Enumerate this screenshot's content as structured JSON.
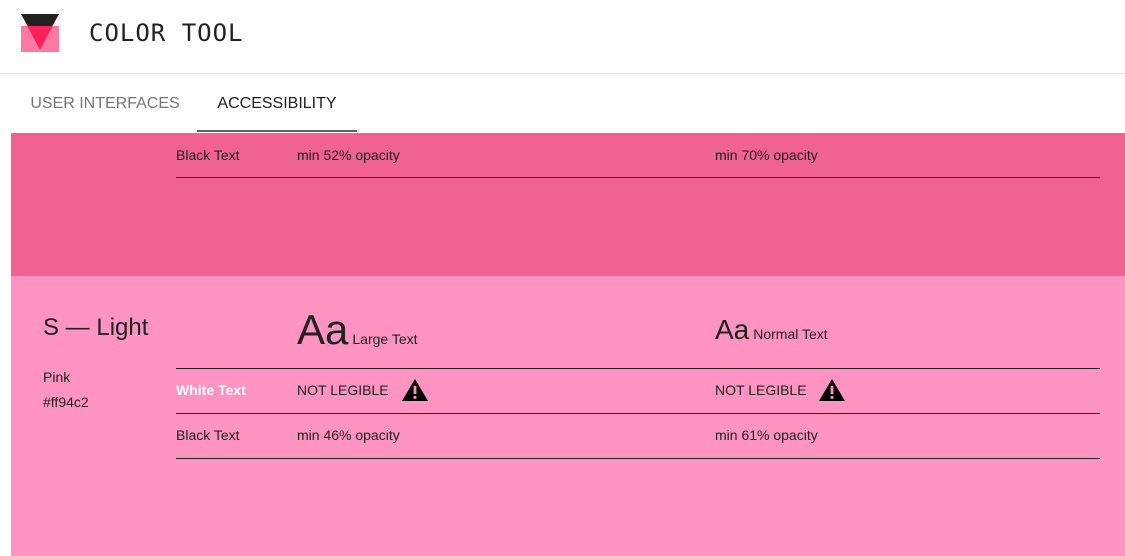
{
  "app": {
    "title": "COLOR TOOL"
  },
  "tabs": [
    {
      "label": "USER INTERFACES",
      "active": false
    },
    {
      "label": "ACCESSIBILITY",
      "active": true
    }
  ],
  "top_panel": {
    "color": "#f06292",
    "black_row": {
      "label": "Black Text",
      "large": "min 52% opacity",
      "normal": "min 70% opacity"
    }
  },
  "light_panel": {
    "title": "S — Light",
    "color_name": "Pink",
    "hex": "#ff94c2",
    "large_sample": {
      "glyph": "Aa",
      "caption": "Large Text"
    },
    "normal_sample": {
      "glyph": "Aa",
      "caption": "Normal Text"
    },
    "white_row": {
      "label": "White Text",
      "large": "NOT LEGIBLE",
      "normal": "NOT LEGIBLE",
      "icon": "warning-icon"
    },
    "black_row": {
      "label": "Black Text",
      "large": "min 46% opacity",
      "normal": "min 61% opacity"
    }
  }
}
